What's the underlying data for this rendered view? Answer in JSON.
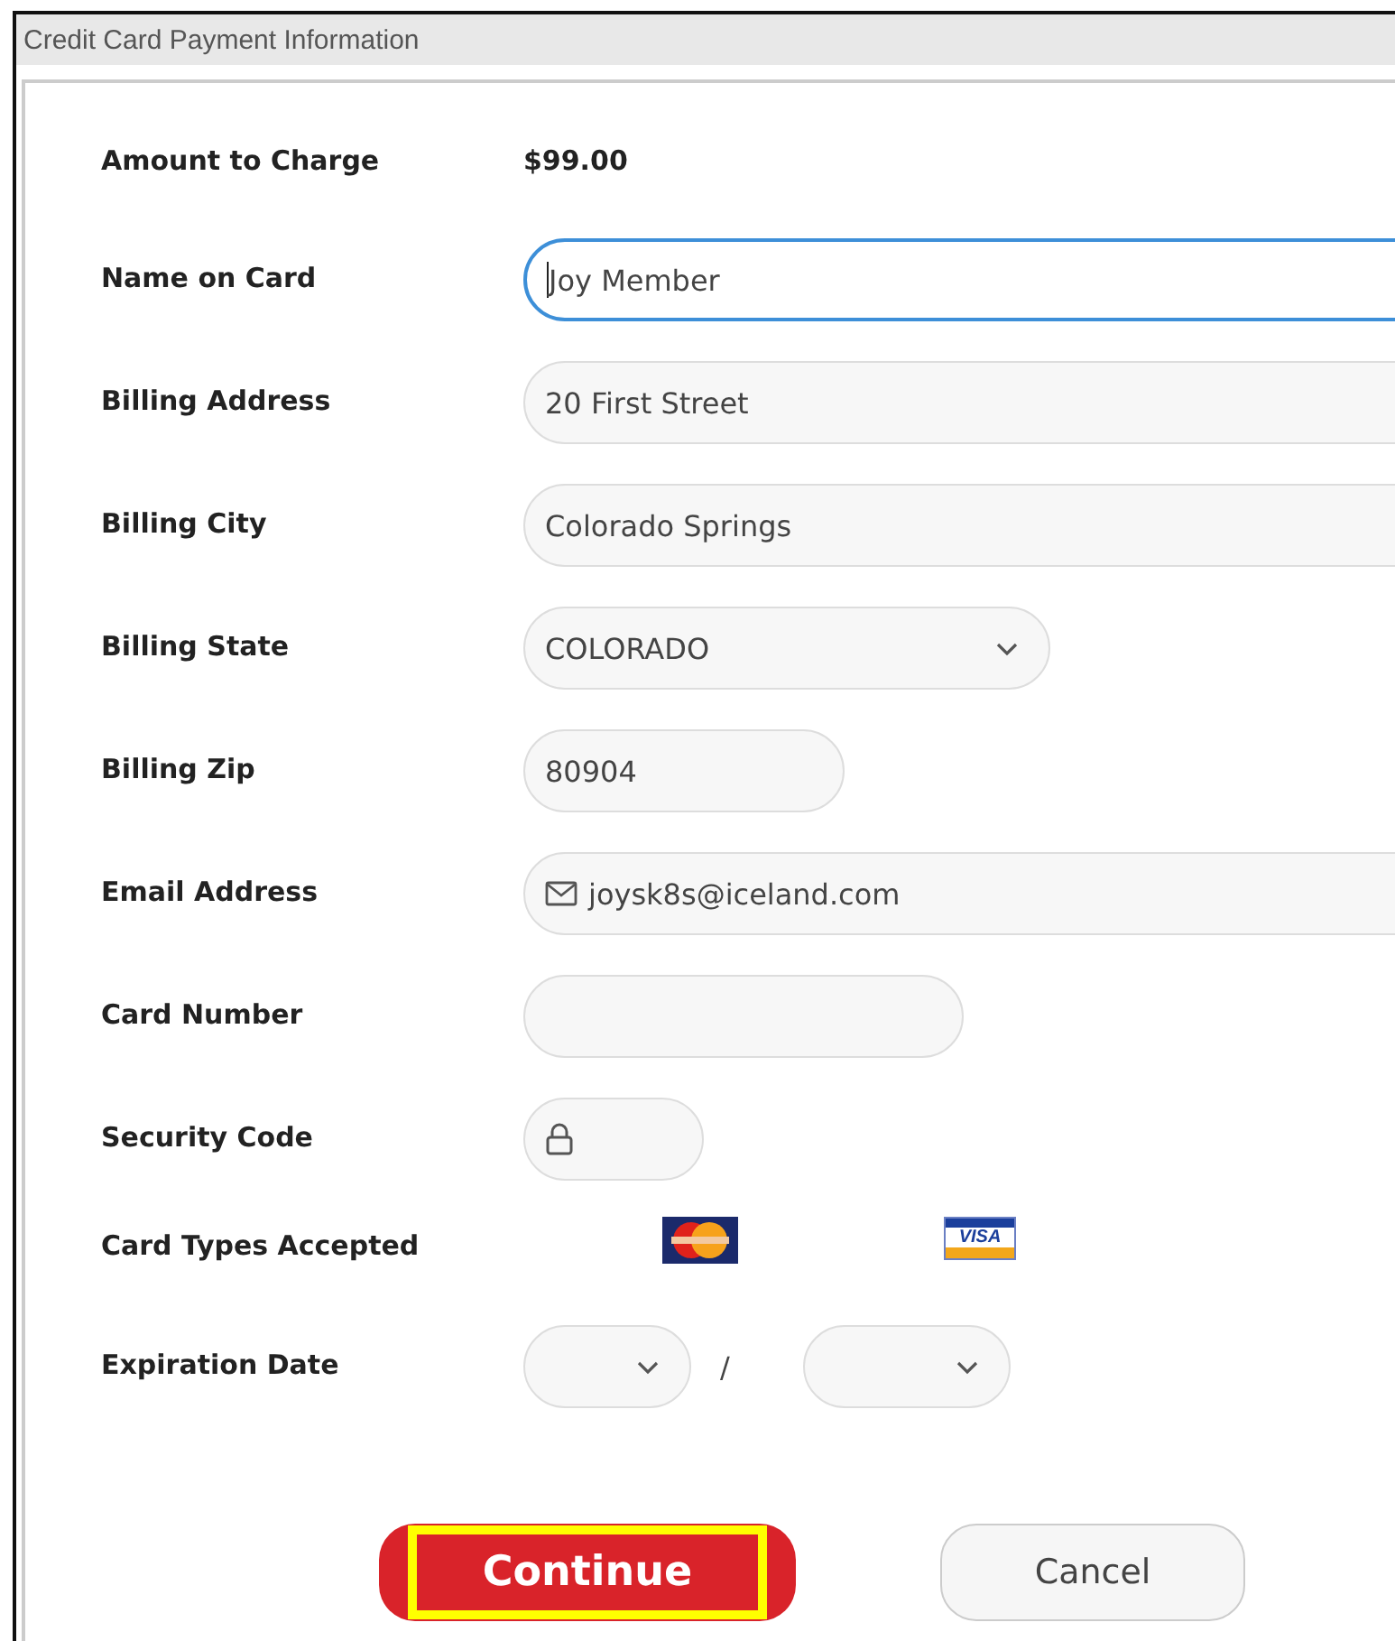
{
  "panel": {
    "title": "Credit Card Payment Information"
  },
  "fields": [
    {
      "label": "Amount to Charge",
      "kind": "static",
      "value": "$99.00"
    },
    {
      "label": "Name on Card",
      "kind": "text",
      "value": "Joy Member",
      "focused": true
    },
    {
      "label": "Billing Address",
      "kind": "text",
      "value": "20 First Street",
      "focused": false
    },
    {
      "label": "Billing City",
      "kind": "text",
      "value": "Colorado Springs",
      "focused": false
    },
    {
      "label": "Billing State",
      "kind": "select",
      "value": "COLORADO",
      "focused": false
    },
    {
      "label": "Billing Zip",
      "kind": "text",
      "value": "80904",
      "focused": false
    },
    {
      "label": "Email Address",
      "kind": "email",
      "value": "joysk8s@iceland.com",
      "focused": false
    },
    {
      "label": "Card Number",
      "kind": "text",
      "focused": false
    },
    {
      "label": "Security Code",
      "kind": "secure",
      "focused": false
    },
    {
      "label": "Card Types Accepted",
      "kind": "cards",
      "visa_text": "VISA"
    },
    {
      "label": "Expiration Date",
      "kind": "expiry",
      "separator": "/"
    }
  ],
  "buttons": [
    {
      "label": "Continue",
      "kind": "primary",
      "highlighted": true
    },
    {
      "label": "Cancel",
      "kind": "secondary",
      "highlighted": false
    }
  ]
}
